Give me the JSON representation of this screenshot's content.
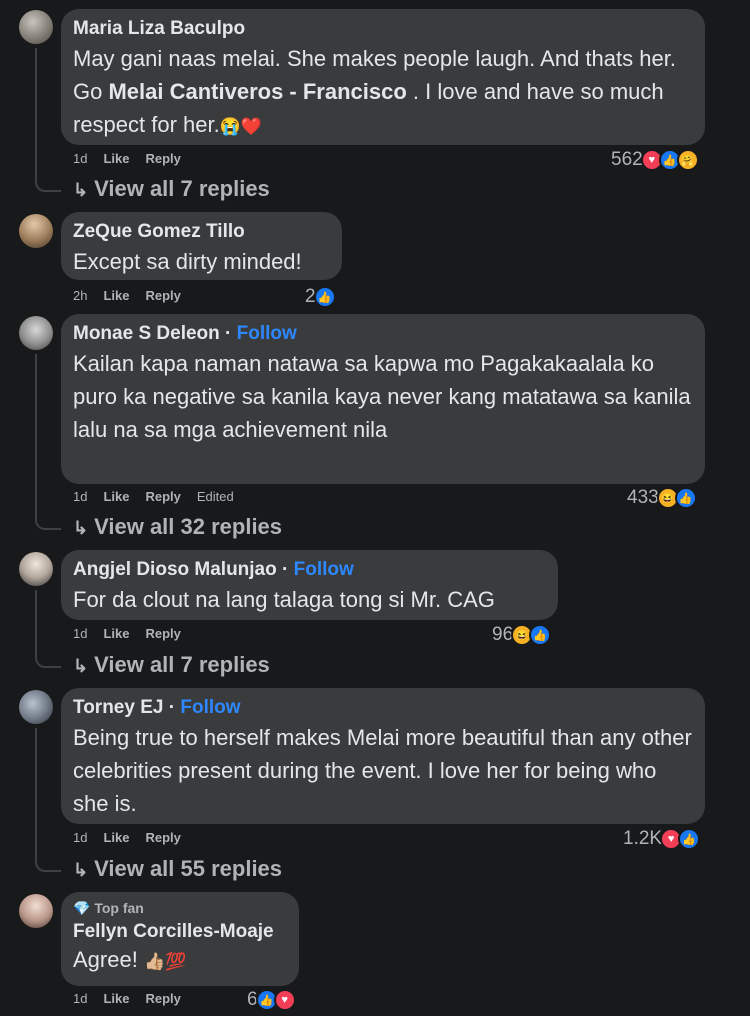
{
  "comments": [
    {
      "name": "Maria Liza Baculpo",
      "text_parts": [
        "May gani naas melai. She makes people laugh. And thats her. Go ",
        "Melai Cantiveros - Francisco",
        " . I love and have so much respect for her."
      ],
      "emoji": "😭❤️",
      "time": "1d",
      "like": "Like",
      "reply": "Reply",
      "reaction_count": "562",
      "reactions": [
        "love",
        "like",
        "care"
      ],
      "replies": "View all 7 replies"
    },
    {
      "name": "ZeQue Gomez Tillo",
      "text": "Except sa dirty minded!",
      "time": "2h",
      "like": "Like",
      "reply": "Reply",
      "reaction_count": "2",
      "reactions": [
        "like"
      ]
    },
    {
      "name": "Monae S Deleon",
      "follow": "Follow",
      "text": "Kailan kapa naman natawa sa kapwa mo Pagakakaalala ko puro ka negative sa kanila kaya never kang matatawa sa kanila lalu na sa mga achievement nila",
      "time": "1d",
      "like": "Like",
      "reply": "Reply",
      "edited": "Edited",
      "reaction_count": "433",
      "reactions": [
        "haha",
        "like"
      ],
      "replies": "View all 32 replies"
    },
    {
      "name": "Angjel Dioso Malunjao",
      "follow": "Follow",
      "text": "For da clout na lang talaga tong si Mr. CAG",
      "time": "1d",
      "like": "Like",
      "reply": "Reply",
      "reaction_count": "96",
      "reactions": [
        "haha",
        "like"
      ],
      "replies": "View all 7 replies"
    },
    {
      "name": "Torney EJ",
      "follow": "Follow",
      "text": "Being true to herself makes Melai more beautiful than any other celebrities present during the event. I love her for being who she is.",
      "time": "1d",
      "like": "Like",
      "reply": "Reply",
      "reaction_count": "1.2K",
      "reactions": [
        "love",
        "like"
      ],
      "replies": "View all 55 replies"
    },
    {
      "badge": "Top fan",
      "name": "Fellyn Corcilles-Moaje",
      "text": "Agree!",
      "emoji": "👍🏼💯",
      "time": "1d",
      "like": "Like",
      "reply": "Reply",
      "reaction_count": "6",
      "reactions": [
        "like",
        "love"
      ]
    }
  ],
  "icons": {
    "like": "👍",
    "love": "♥",
    "haha": "😆",
    "care": "🤗",
    "reply_arrow": "↳",
    "top_fan": "💎"
  },
  "colors": {
    "background": "#18191a",
    "bubble": "#3a3b3c",
    "follow": "#2d88ff",
    "muted": "#b0b3b8",
    "text": "#e4e6eb"
  }
}
